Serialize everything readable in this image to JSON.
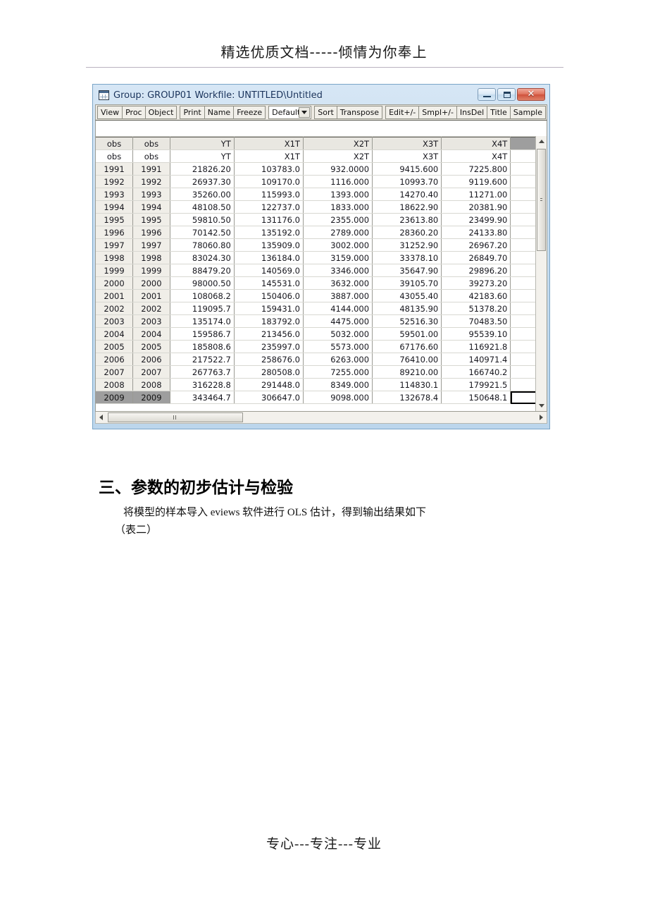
{
  "page": {
    "header_text": "精选优质文档-----倾情为你奉上",
    "footer_text": "专心---专注---专业"
  },
  "window": {
    "title": "Group: GROUP01   Workfile: UNTITLED\\Untitled",
    "icon": "spreadsheet-icon",
    "buttons": {
      "minimize": "minimize-icon",
      "restore": "restore-icon",
      "close": "✕"
    }
  },
  "toolbar": {
    "group_a": [
      "View",
      "Proc",
      "Object"
    ],
    "group_b": [
      "Print",
      "Name",
      "Freeze"
    ],
    "combo_value": "Default",
    "group_c": [
      "Sort",
      "Transpose"
    ],
    "group_d": [
      "Edit+/-",
      "Smpl+/-",
      "InsDel",
      "Title",
      "Sample"
    ]
  },
  "grid": {
    "headers": [
      "obs",
      "obs",
      "YT",
      "X1T",
      "X2T",
      "X3T",
      "X4T",
      ""
    ],
    "subheaders": [
      "obs",
      "obs",
      "YT",
      "X1T",
      "X2T",
      "X3T",
      "X4T",
      ""
    ],
    "selected_row": "2009",
    "rows": [
      [
        "1991",
        "1991",
        "21826.20",
        "103783.0",
        "932.0000",
        "9415.600",
        "7225.800",
        ""
      ],
      [
        "1992",
        "1992",
        "26937.30",
        "109170.0",
        "1116.000",
        "10993.70",
        "9119.600",
        ""
      ],
      [
        "1993",
        "1993",
        "35260.00",
        "115993.0",
        "1393.000",
        "14270.40",
        "11271.00",
        ""
      ],
      [
        "1994",
        "1994",
        "48108.50",
        "122737.0",
        "1833.000",
        "18622.90",
        "20381.90",
        ""
      ],
      [
        "1995",
        "1995",
        "59810.50",
        "131176.0",
        "2355.000",
        "23613.80",
        "23499.90",
        ""
      ],
      [
        "1996",
        "1996",
        "70142.50",
        "135192.0",
        "2789.000",
        "28360.20",
        "24133.80",
        ""
      ],
      [
        "1997",
        "1997",
        "78060.80",
        "135909.0",
        "3002.000",
        "31252.90",
        "26967.20",
        ""
      ],
      [
        "1998",
        "1998",
        "83024.30",
        "136184.0",
        "3159.000",
        "33378.10",
        "26849.70",
        ""
      ],
      [
        "1999",
        "1999",
        "88479.20",
        "140569.0",
        "3346.000",
        "35647.90",
        "29896.20",
        ""
      ],
      [
        "2000",
        "2000",
        "98000.50",
        "145531.0",
        "3632.000",
        "39105.70",
        "39273.20",
        ""
      ],
      [
        "2001",
        "2001",
        "108068.2",
        "150406.0",
        "3887.000",
        "43055.40",
        "42183.60",
        ""
      ],
      [
        "2002",
        "2002",
        "119095.7",
        "159431.0",
        "4144.000",
        "48135.90",
        "51378.20",
        ""
      ],
      [
        "2003",
        "2003",
        "135174.0",
        "183792.0",
        "4475.000",
        "52516.30",
        "70483.50",
        ""
      ],
      [
        "2004",
        "2004",
        "159586.7",
        "213456.0",
        "5032.000",
        "59501.00",
        "95539.10",
        ""
      ],
      [
        "2005",
        "2005",
        "185808.6",
        "235997.0",
        "5573.000",
        "67176.60",
        "116921.8",
        ""
      ],
      [
        "2006",
        "2006",
        "217522.7",
        "258676.0",
        "6263.000",
        "76410.00",
        "140971.4",
        ""
      ],
      [
        "2007",
        "2007",
        "267763.7",
        "280508.0",
        "7255.000",
        "89210.00",
        "166740.2",
        ""
      ],
      [
        "2008",
        "2008",
        "316228.8",
        "291448.0",
        "8349.000",
        "114830.1",
        "179921.5",
        ""
      ],
      [
        "2009",
        "2009",
        "343464.7",
        "306647.0",
        "9098.000",
        "132678.4",
        "150648.1",
        ""
      ]
    ]
  },
  "document": {
    "heading": "三、参数的初步估计与检验",
    "paragraph": "将模型的样本导入 eviews 软件进行 OLS 估计，得到输出结果如下",
    "paragraph2": "（表二）"
  }
}
